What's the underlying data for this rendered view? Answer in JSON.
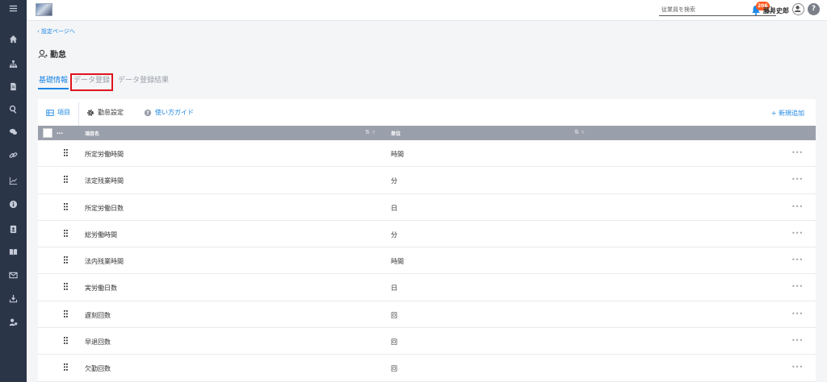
{
  "topbar": {
    "search_placeholder": "従業員を検索",
    "notification_count": "206",
    "user_name": "藤井史郎"
  },
  "breadcrumb": {
    "back_label": "設定ページへ"
  },
  "page": {
    "title": "勤怠"
  },
  "tabs": [
    {
      "label": "基礎情報"
    },
    {
      "label": "データ登録"
    },
    {
      "label": "データ登録結果"
    }
  ],
  "subtabs": [
    {
      "label": "項目"
    },
    {
      "label": "勤怠設定"
    },
    {
      "label": "使い方ガイド"
    }
  ],
  "add_new_label": "+ 新規追加",
  "table": {
    "columns": [
      "項目名",
      "単位"
    ],
    "rows": [
      {
        "name": "所定労働時間",
        "unit": "時間"
      },
      {
        "name": "法定残業時間",
        "unit": "分"
      },
      {
        "name": "所定労働日数",
        "unit": "日"
      },
      {
        "name": "総労働時間",
        "unit": "分"
      },
      {
        "name": "法内残業時間",
        "unit": "時間"
      },
      {
        "name": "実労働日数",
        "unit": "日"
      },
      {
        "name": "遅刻回数",
        "unit": "回"
      },
      {
        "name": "早退回数",
        "unit": "回"
      },
      {
        "name": "欠勤回数",
        "unit": "回"
      }
    ]
  },
  "colors": {
    "accent": "#1e88e5",
    "sidebar": "#2b3548",
    "table_header": "#9aa0ab",
    "highlight": "#e0141e",
    "badge": "#ff5a1f"
  }
}
